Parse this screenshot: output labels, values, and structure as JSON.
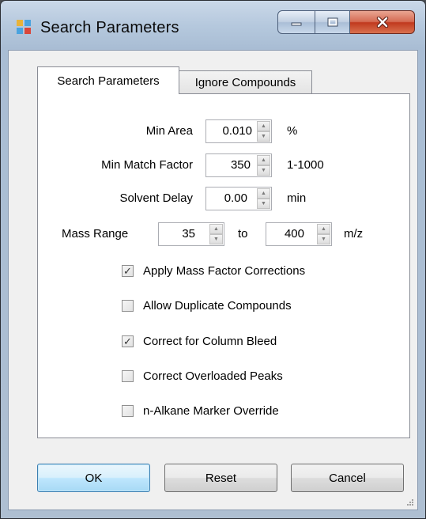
{
  "window": {
    "title": "Search Parameters",
    "controls": [
      "minimize-icon",
      "maximize-icon",
      "close-icon"
    ]
  },
  "tabs": [
    {
      "label": "Search Parameters",
      "active": true
    },
    {
      "label": "Ignore Compounds",
      "active": false
    }
  ],
  "fields": {
    "min_area": {
      "label": "Min Area",
      "value": "0.010",
      "unit": "%"
    },
    "min_match_factor": {
      "label": "Min Match Factor",
      "value": "350",
      "unit": "1-1000"
    },
    "solvent_delay": {
      "label": "Solvent Delay",
      "value": "0.00",
      "unit": "min"
    },
    "mass_range": {
      "label": "Mass Range",
      "from": "35",
      "separator": "to",
      "to": "400",
      "unit": "m/z"
    }
  },
  "checkboxes": [
    {
      "label": "Apply Mass Factor Corrections",
      "checked": true
    },
    {
      "label": "Allow Duplicate Compounds",
      "checked": false
    },
    {
      "label": "Correct for Column Bleed",
      "checked": true
    },
    {
      "label": "Correct Overloaded Peaks",
      "checked": false
    },
    {
      "label": "n-Alkane Marker Override",
      "checked": false
    }
  ],
  "buttons": {
    "ok": "OK",
    "reset": "Reset",
    "cancel": "Cancel"
  },
  "check_glyph": "✓",
  "colors": {
    "close_button": "#c0391e",
    "default_button_border": "#3c7fb1",
    "title_bar": "#b6c9de"
  }
}
